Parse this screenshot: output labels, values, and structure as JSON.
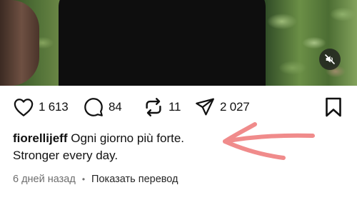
{
  "post": {
    "media": {
      "mute_icon": "speaker-muted-icon"
    },
    "actions": {
      "like": {
        "icon": "heart-icon",
        "count": "1 613"
      },
      "comment": {
        "icon": "comment-icon",
        "count": "84"
      },
      "repost": {
        "icon": "repost-icon",
        "count": "11"
      },
      "share": {
        "icon": "send-icon",
        "count": "2 027"
      },
      "save": {
        "icon": "bookmark-icon"
      }
    },
    "caption": {
      "username": "fiorellijeff",
      "text_line1": "Ogni giorno più forte.",
      "text_line2": "Stronger every day."
    },
    "meta": {
      "time_ago": "6 дней назад",
      "separator": "•",
      "translate_link": "Показать перевод"
    },
    "annotation": {
      "type": "hand-drawn-arrow",
      "color": "#f08b8b"
    }
  }
}
